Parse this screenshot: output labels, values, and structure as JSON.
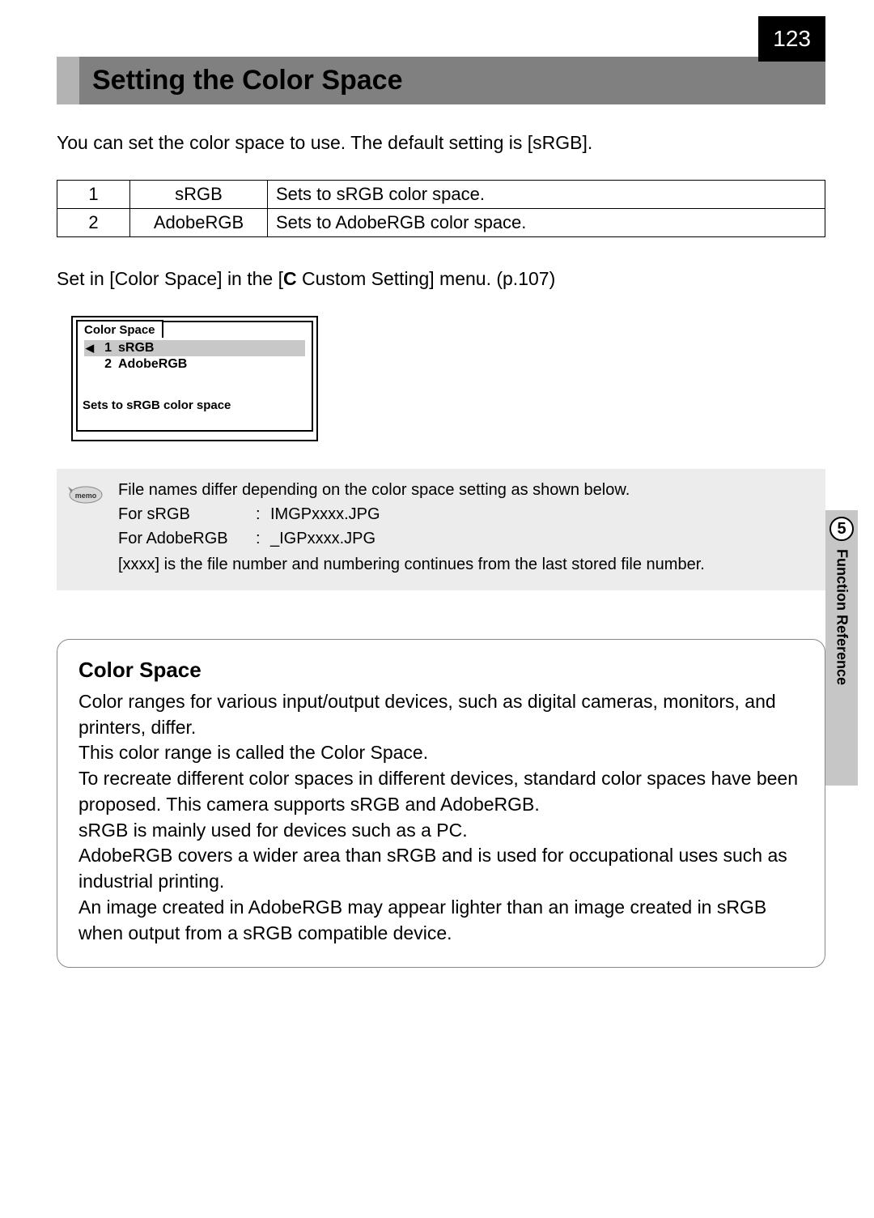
{
  "page_number": "123",
  "heading": "Setting the Color Space",
  "intro": "You can set the color space to use. The default setting is [sRGB].",
  "options": [
    {
      "num": "1",
      "name": "sRGB",
      "desc": "Sets to sRGB color space."
    },
    {
      "num": "2",
      "name": "AdobeRGB",
      "desc": "Sets to AdobeRGB color space."
    }
  ],
  "menu_ref_prefix": "Set in [Color Space] in the [",
  "menu_ref_c": "C",
  "menu_ref_suffix": " Custom Setting] menu. (p.107)",
  "lcd": {
    "tab": "Color Space",
    "items": [
      {
        "num": "1",
        "label": "sRGB",
        "selected": true
      },
      {
        "num": "2",
        "label": "AdobeRGB",
        "selected": false
      }
    ],
    "desc": "Sets to sRGB color space"
  },
  "memo": {
    "icon_label": "memo",
    "line1": "File names differ depending on the color space setting as shown below.",
    "rows": [
      {
        "label": "For sRGB",
        "value": "IMGPxxxx.JPG"
      },
      {
        "label": "For AdobeRGB",
        "value": "_IGPxxxx.JPG"
      }
    ],
    "note": "[xxxx] is the file number and numbering continues from the last stored file number."
  },
  "info_box": {
    "title": "Color Space",
    "paragraphs": [
      "Color ranges for various input/output devices, such as digital cameras, monitors, and printers, differ.",
      "This color range is called the Color Space.",
      "To recreate different color spaces in different devices, standard color spaces have been proposed. This camera supports sRGB and AdobeRGB.",
      "sRGB is mainly used for devices such as a PC.",
      "AdobeRGB covers a wider area than sRGB and is used for occupational uses such as industrial printing.",
      "An image created in AdobeRGB may appear lighter than an image created in sRGB when output from a sRGB compatible device."
    ]
  },
  "side_tab": {
    "chapter": "5",
    "label": "Function Reference"
  }
}
